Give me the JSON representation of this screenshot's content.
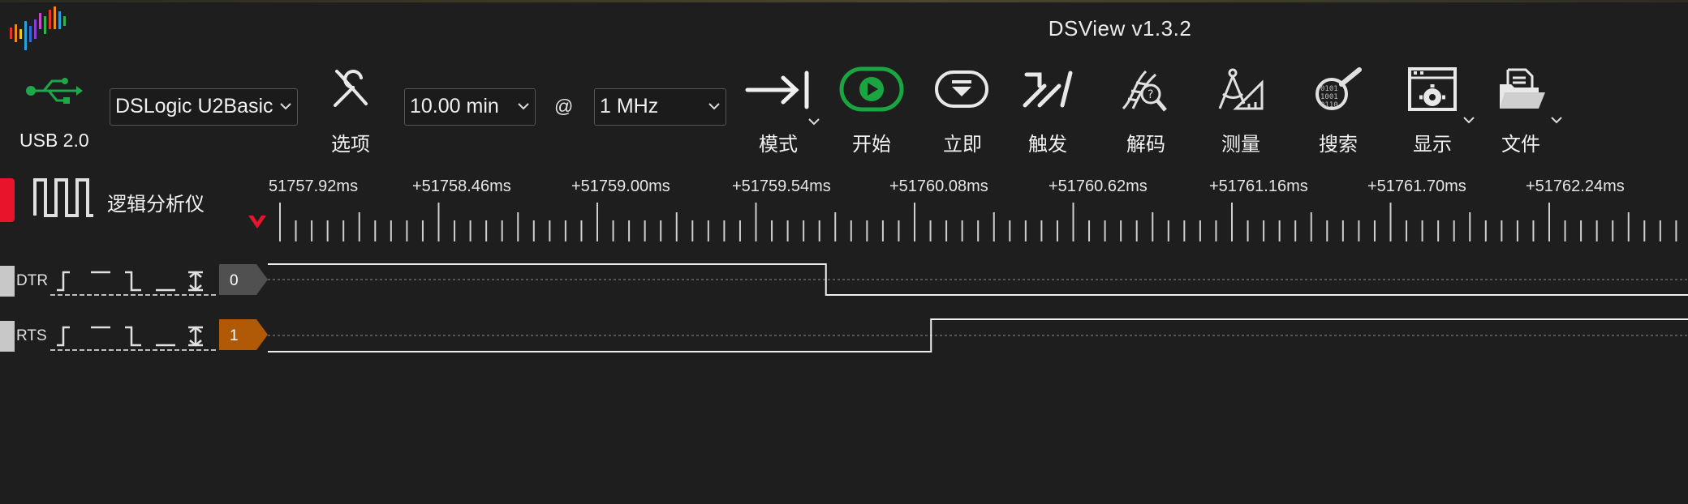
{
  "window": {
    "title": "DSView v1.3.2"
  },
  "toolbar": {
    "usb_label": "USB 2.0",
    "device": "DSLogic U2Basic",
    "options_label": "选项",
    "duration": "10.00 min",
    "at_symbol": "@",
    "sample_rate": "1 MHz",
    "mode_label": "模式",
    "start_label": "开始",
    "instant_label": "立即",
    "trigger_label": "触发",
    "decode_label": "解码",
    "measure_label": "测量",
    "search_label": "搜索",
    "display_label": "显示",
    "file_label": "文件"
  },
  "panel": {
    "title": "逻辑分析仪"
  },
  "ruler": {
    "labels": [
      "51757.92ms",
      "+51758.46ms",
      "+51759.00ms",
      "+51759.54ms",
      "+51760.08ms",
      "+51760.62ms",
      "+51761.16ms",
      "+51761.70ms",
      "+51762.24ms"
    ]
  },
  "channels": [
    {
      "name": "DTR",
      "index": "0",
      "badge_color": "#505050",
      "transition": 0.393
    },
    {
      "name": "RTS",
      "index": "1",
      "badge_color": "#b05a07",
      "transition": 0.467
    }
  ],
  "colors": {
    "start_green": "#19a640",
    "usb_green": "#1fa84a",
    "marker_red": "#e8142b"
  }
}
